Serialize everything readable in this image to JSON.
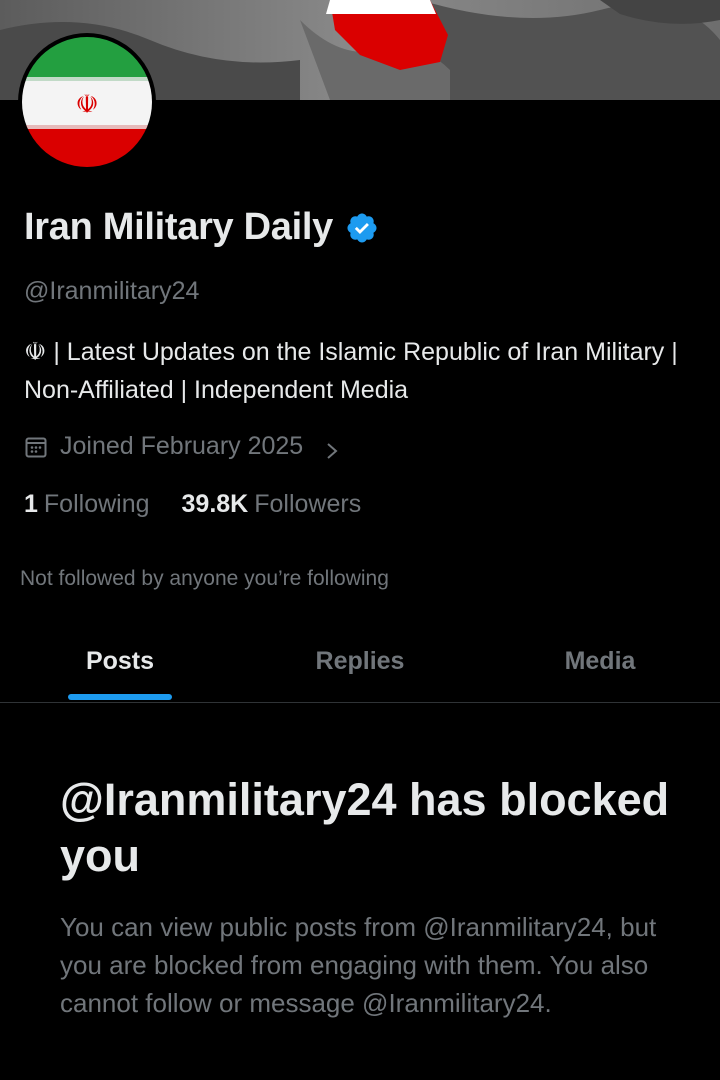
{
  "profile": {
    "display_name": "Iran Military Daily",
    "handle": "@Iranmilitary24",
    "bio": "☫ | Latest Updates on the Islamic Republic of Iran Military | Non-Affiliated | Independent Media",
    "joined": "Joined February 2025",
    "following_count": "1",
    "following_label": "Following",
    "followers_count": "39.8K",
    "followers_label": "Followers",
    "not_followed_text": "Not followed by anyone you’re following"
  },
  "icons": {
    "verified": "verified-badge-icon",
    "calendar": "calendar-icon",
    "chevron": "chevron-right-icon"
  },
  "tabs": [
    {
      "label": "Posts",
      "active": true
    },
    {
      "label": "Replies",
      "active": false
    },
    {
      "label": "Media",
      "active": false
    }
  ],
  "blocked": {
    "title": "@Iranmilitary24 has blocked you",
    "description": "You can view public posts from @Iranmilitary24, but you are blocked from engaging with them. You also cannot follow or message @Iranmilitary24."
  },
  "colors": {
    "background": "#000000",
    "primary_text": "#e7e9ea",
    "secondary_text": "#71767b",
    "accent": "#1d9bf0",
    "flag_green": "#239f40",
    "flag_red": "#da0000"
  }
}
